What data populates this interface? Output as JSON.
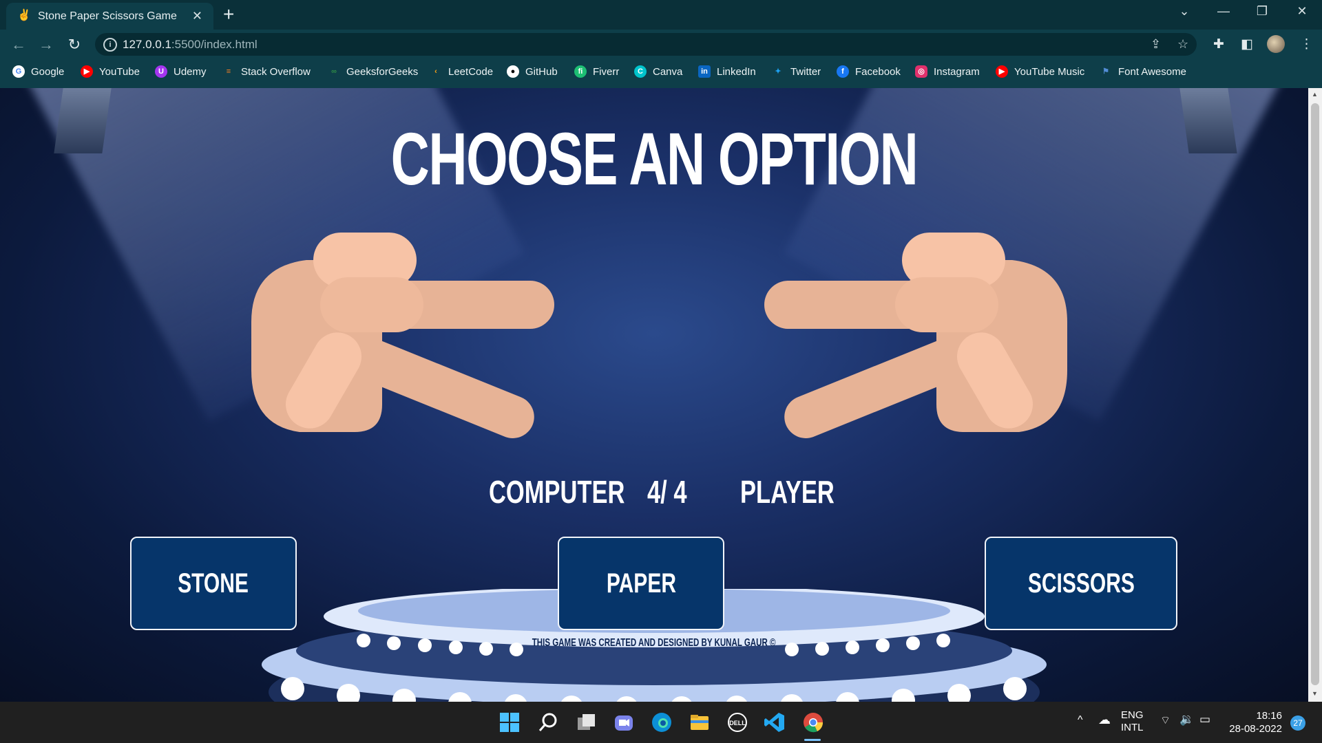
{
  "browser": {
    "tab_title": "Stone Paper Scissors Game",
    "tab_close": "✕",
    "new_tab": "+",
    "url_host": "127.0.0.1",
    "url_path": ":5500/index.html",
    "bookmarks": [
      {
        "label": "Google",
        "color": "#ffffff"
      },
      {
        "label": "YouTube",
        "color": "#ff0000"
      },
      {
        "label": "Udemy",
        "color": "#a435f0"
      },
      {
        "label": "Stack Overflow",
        "color": "#f48024"
      },
      {
        "label": "GeeksforGeeks",
        "color": "#2f8d46"
      },
      {
        "label": "LeetCode",
        "color": "#ffa116"
      },
      {
        "label": "GitHub",
        "color": "#ffffff"
      },
      {
        "label": "Fiverr",
        "color": "#1dbf73"
      },
      {
        "label": "Canva",
        "color": "#00c4cc"
      },
      {
        "label": "LinkedIn",
        "color": "#0a66c2"
      },
      {
        "label": "Twitter",
        "color": "#1da1f2"
      },
      {
        "label": "Facebook",
        "color": "#1877f2"
      },
      {
        "label": "Instagram",
        "color": "#e1306c"
      },
      {
        "label": "YouTube Music",
        "color": "#ff0000"
      },
      {
        "label": "Font Awesome",
        "color": "#538dd7"
      }
    ]
  },
  "game": {
    "title": "CHOOSE AN OPTION",
    "computer_label": "COMPUTER",
    "score": "4/ 4",
    "player_label": "PLAYER",
    "options": [
      "STONE",
      "PAPER",
      "SCISSORS"
    ],
    "footer": "THIS GAME WAS CREATED AND DESIGNED BY KUNAL GAUR ©"
  },
  "taskbar": {
    "lang_top": "ENG",
    "lang_bottom": "INTL",
    "time": "18:16",
    "date": "28-08-2022",
    "notification_count": "27"
  }
}
